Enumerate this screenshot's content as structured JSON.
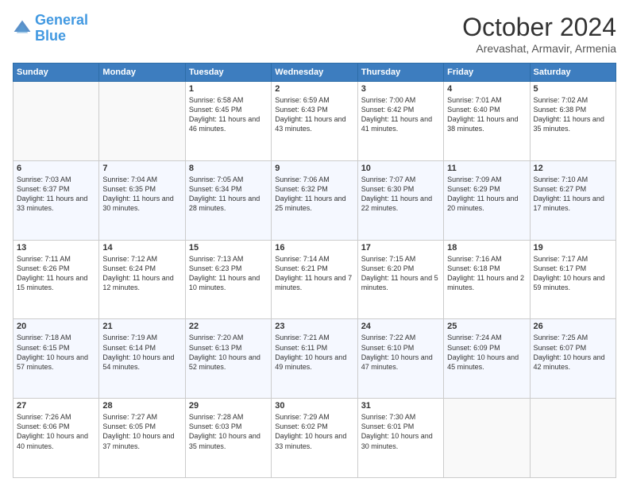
{
  "header": {
    "logo_line1": "General",
    "logo_line2": "Blue",
    "month": "October 2024",
    "location": "Arevashat, Armavir, Armenia"
  },
  "weekdays": [
    "Sunday",
    "Monday",
    "Tuesday",
    "Wednesday",
    "Thursday",
    "Friday",
    "Saturday"
  ],
  "weeks": [
    [
      {
        "day": "",
        "sunrise": "",
        "sunset": "",
        "daylight": ""
      },
      {
        "day": "",
        "sunrise": "",
        "sunset": "",
        "daylight": ""
      },
      {
        "day": "1",
        "sunrise": "Sunrise: 6:58 AM",
        "sunset": "Sunset: 6:45 PM",
        "daylight": "Daylight: 11 hours and 46 minutes."
      },
      {
        "day": "2",
        "sunrise": "Sunrise: 6:59 AM",
        "sunset": "Sunset: 6:43 PM",
        "daylight": "Daylight: 11 hours and 43 minutes."
      },
      {
        "day": "3",
        "sunrise": "Sunrise: 7:00 AM",
        "sunset": "Sunset: 6:42 PM",
        "daylight": "Daylight: 11 hours and 41 minutes."
      },
      {
        "day": "4",
        "sunrise": "Sunrise: 7:01 AM",
        "sunset": "Sunset: 6:40 PM",
        "daylight": "Daylight: 11 hours and 38 minutes."
      },
      {
        "day": "5",
        "sunrise": "Sunrise: 7:02 AM",
        "sunset": "Sunset: 6:38 PM",
        "daylight": "Daylight: 11 hours and 35 minutes."
      }
    ],
    [
      {
        "day": "6",
        "sunrise": "Sunrise: 7:03 AM",
        "sunset": "Sunset: 6:37 PM",
        "daylight": "Daylight: 11 hours and 33 minutes."
      },
      {
        "day": "7",
        "sunrise": "Sunrise: 7:04 AM",
        "sunset": "Sunset: 6:35 PM",
        "daylight": "Daylight: 11 hours and 30 minutes."
      },
      {
        "day": "8",
        "sunrise": "Sunrise: 7:05 AM",
        "sunset": "Sunset: 6:34 PM",
        "daylight": "Daylight: 11 hours and 28 minutes."
      },
      {
        "day": "9",
        "sunrise": "Sunrise: 7:06 AM",
        "sunset": "Sunset: 6:32 PM",
        "daylight": "Daylight: 11 hours and 25 minutes."
      },
      {
        "day": "10",
        "sunrise": "Sunrise: 7:07 AM",
        "sunset": "Sunset: 6:30 PM",
        "daylight": "Daylight: 11 hours and 22 minutes."
      },
      {
        "day": "11",
        "sunrise": "Sunrise: 7:09 AM",
        "sunset": "Sunset: 6:29 PM",
        "daylight": "Daylight: 11 hours and 20 minutes."
      },
      {
        "day": "12",
        "sunrise": "Sunrise: 7:10 AM",
        "sunset": "Sunset: 6:27 PM",
        "daylight": "Daylight: 11 hours and 17 minutes."
      }
    ],
    [
      {
        "day": "13",
        "sunrise": "Sunrise: 7:11 AM",
        "sunset": "Sunset: 6:26 PM",
        "daylight": "Daylight: 11 hours and 15 minutes."
      },
      {
        "day": "14",
        "sunrise": "Sunrise: 7:12 AM",
        "sunset": "Sunset: 6:24 PM",
        "daylight": "Daylight: 11 hours and 12 minutes."
      },
      {
        "day": "15",
        "sunrise": "Sunrise: 7:13 AM",
        "sunset": "Sunset: 6:23 PM",
        "daylight": "Daylight: 11 hours and 10 minutes."
      },
      {
        "day": "16",
        "sunrise": "Sunrise: 7:14 AM",
        "sunset": "Sunset: 6:21 PM",
        "daylight": "Daylight: 11 hours and 7 minutes."
      },
      {
        "day": "17",
        "sunrise": "Sunrise: 7:15 AM",
        "sunset": "Sunset: 6:20 PM",
        "daylight": "Daylight: 11 hours and 5 minutes."
      },
      {
        "day": "18",
        "sunrise": "Sunrise: 7:16 AM",
        "sunset": "Sunset: 6:18 PM",
        "daylight": "Daylight: 11 hours and 2 minutes."
      },
      {
        "day": "19",
        "sunrise": "Sunrise: 7:17 AM",
        "sunset": "Sunset: 6:17 PM",
        "daylight": "Daylight: 10 hours and 59 minutes."
      }
    ],
    [
      {
        "day": "20",
        "sunrise": "Sunrise: 7:18 AM",
        "sunset": "Sunset: 6:15 PM",
        "daylight": "Daylight: 10 hours and 57 minutes."
      },
      {
        "day": "21",
        "sunrise": "Sunrise: 7:19 AM",
        "sunset": "Sunset: 6:14 PM",
        "daylight": "Daylight: 10 hours and 54 minutes."
      },
      {
        "day": "22",
        "sunrise": "Sunrise: 7:20 AM",
        "sunset": "Sunset: 6:13 PM",
        "daylight": "Daylight: 10 hours and 52 minutes."
      },
      {
        "day": "23",
        "sunrise": "Sunrise: 7:21 AM",
        "sunset": "Sunset: 6:11 PM",
        "daylight": "Daylight: 10 hours and 49 minutes."
      },
      {
        "day": "24",
        "sunrise": "Sunrise: 7:22 AM",
        "sunset": "Sunset: 6:10 PM",
        "daylight": "Daylight: 10 hours and 47 minutes."
      },
      {
        "day": "25",
        "sunrise": "Sunrise: 7:24 AM",
        "sunset": "Sunset: 6:09 PM",
        "daylight": "Daylight: 10 hours and 45 minutes."
      },
      {
        "day": "26",
        "sunrise": "Sunrise: 7:25 AM",
        "sunset": "Sunset: 6:07 PM",
        "daylight": "Daylight: 10 hours and 42 minutes."
      }
    ],
    [
      {
        "day": "27",
        "sunrise": "Sunrise: 7:26 AM",
        "sunset": "Sunset: 6:06 PM",
        "daylight": "Daylight: 10 hours and 40 minutes."
      },
      {
        "day": "28",
        "sunrise": "Sunrise: 7:27 AM",
        "sunset": "Sunset: 6:05 PM",
        "daylight": "Daylight: 10 hours and 37 minutes."
      },
      {
        "day": "29",
        "sunrise": "Sunrise: 7:28 AM",
        "sunset": "Sunset: 6:03 PM",
        "daylight": "Daylight: 10 hours and 35 minutes."
      },
      {
        "day": "30",
        "sunrise": "Sunrise: 7:29 AM",
        "sunset": "Sunset: 6:02 PM",
        "daylight": "Daylight: 10 hours and 33 minutes."
      },
      {
        "day": "31",
        "sunrise": "Sunrise: 7:30 AM",
        "sunset": "Sunset: 6:01 PM",
        "daylight": "Daylight: 10 hours and 30 minutes."
      },
      {
        "day": "",
        "sunrise": "",
        "sunset": "",
        "daylight": ""
      },
      {
        "day": "",
        "sunrise": "",
        "sunset": "",
        "daylight": ""
      }
    ]
  ]
}
